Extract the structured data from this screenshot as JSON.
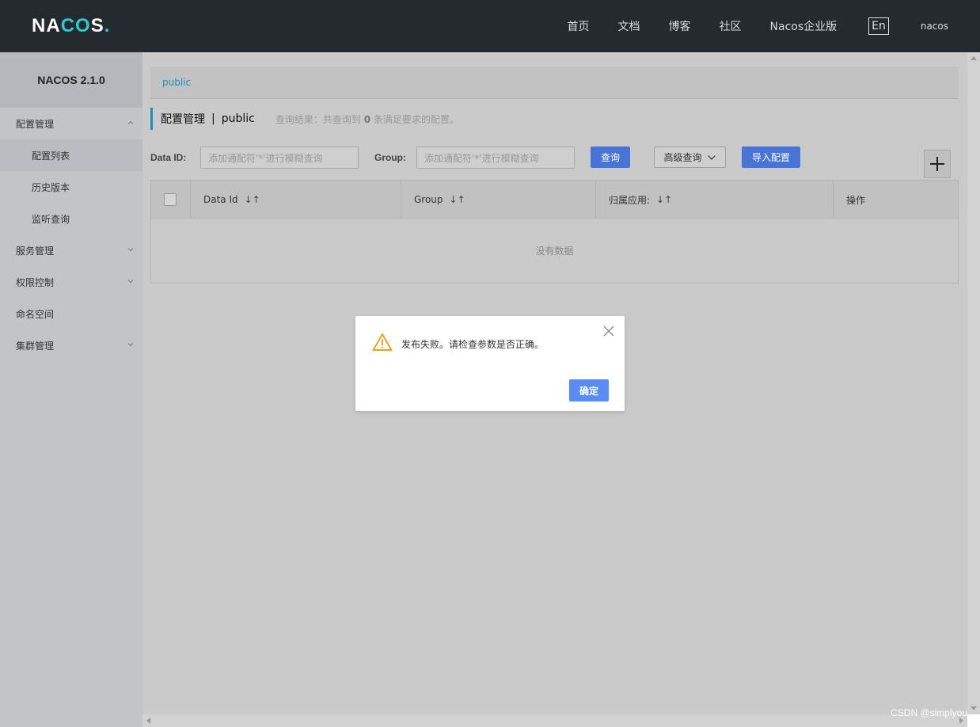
{
  "header": {
    "logo": {
      "n": "N",
      "a": "A",
      "c": "C",
      "o": "O",
      "s": "S",
      "dot": "."
    },
    "nav": [
      "首页",
      "文档",
      "博客",
      "社区",
      "Nacos企业版"
    ],
    "lang": "En",
    "user": "nacos"
  },
  "sidebar": {
    "title": "NACOS 2.1.0",
    "items": [
      {
        "label": "配置管理"
      },
      {
        "label": "配置列表"
      },
      {
        "label": "历史版本"
      },
      {
        "label": "监听查询"
      },
      {
        "label": "服务管理"
      },
      {
        "label": "权限控制"
      },
      {
        "label": "命名空间"
      },
      {
        "label": "集群管理"
      }
    ]
  },
  "main": {
    "namespace": "public",
    "heading": {
      "title": "配置管理",
      "sep": "|",
      "ns": "public",
      "result_prefix": "查询结果：共查询到",
      "result_count": "0",
      "result_suffix": "条满足要求的配置。"
    },
    "search": {
      "dataid_label": "Data ID:",
      "dataid_placeholder": "添加通配符'*'进行模糊查询",
      "group_label": "Group:",
      "group_placeholder": "添加通配符'*'进行模糊查询",
      "query_button": "查询",
      "advanced_button": "高级查询",
      "import_button": "导入配置"
    },
    "table": {
      "columns": [
        "Data Id",
        "Group",
        "归属应用:",
        "操作"
      ],
      "sort_glyph": "↓↑",
      "empty": "没有数据"
    }
  },
  "dialog": {
    "message": "发布失败。请检查参数是否正确。",
    "ok": "确定"
  },
  "watermark": "CSDN @simplyou",
  "colors": {
    "header_bg": "#252a2f",
    "accent": "#1a8fb8",
    "primary_button": "#4874d8",
    "dialog_ok": "#5a8cf5",
    "warning": "#f0a020"
  }
}
